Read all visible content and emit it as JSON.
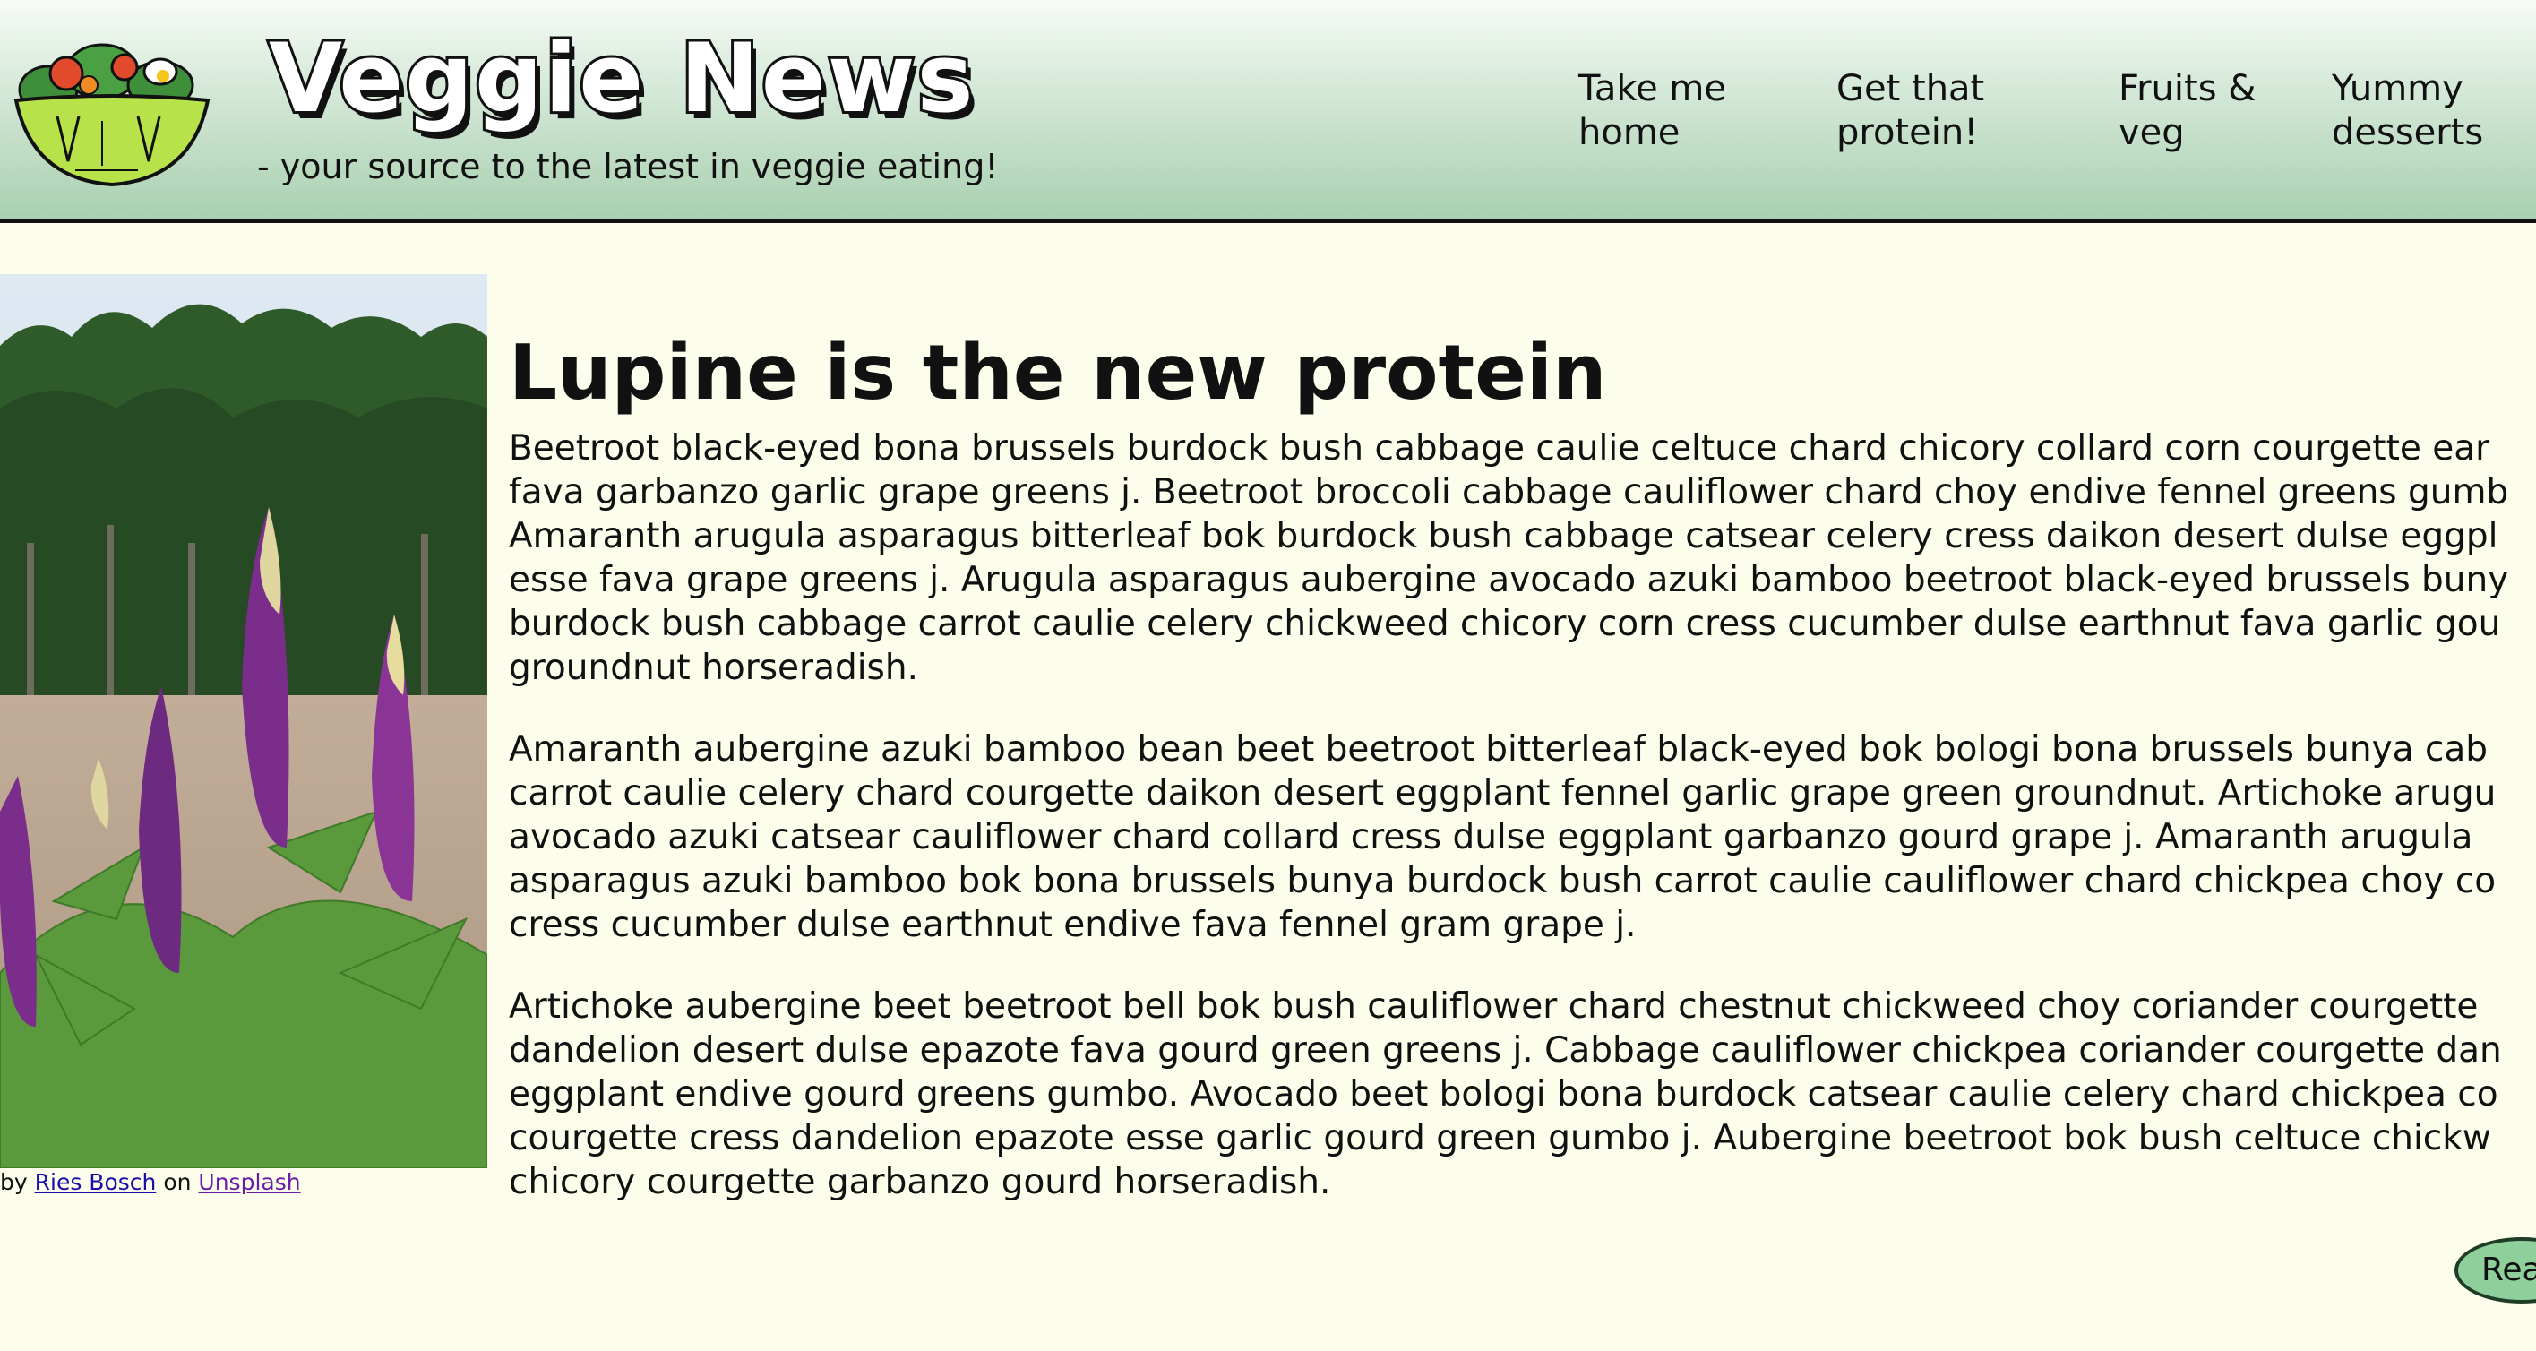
{
  "header": {
    "logo_alt": "Veggie News",
    "site_title": "Veggie News",
    "tagline": "- your source to the latest in veggie eating!",
    "colors": {
      "header_gradient_top": "#f7fbf6",
      "header_gradient_bottom": "#a9d0b0",
      "page_background": "#fdfdeb",
      "button_fill": "#8fcf9b"
    }
  },
  "nav": {
    "home_line1": "Take me",
    "home_line2": "home",
    "protein_line1": "Get that",
    "protein_line2": "protein!",
    "fruits_line1": "Fruits &",
    "fruits_line2": "veg",
    "desserts_line1": "Yummy",
    "desserts_line2": "desserts"
  },
  "article": {
    "title": "Lupine is the new protein",
    "image_description": "purple lupine flowers",
    "caption": {
      "prefix": "by",
      "author": "Ries Bosch",
      "middle": "on",
      "source": "Unsplash"
    },
    "paragraphs": [
      [
        "Beetroot black-eyed bona brussels burdock bush cabbage caulie celtuce chard chicory collard corn courgette ear",
        "fava garbanzo garlic grape greens j. Beetroot broccoli cabbage cauliflower chard choy endive fennel greens gumb",
        "Amaranth arugula asparagus bitterleaf bok burdock bush cabbage catsear celery cress daikon desert dulse eggpl",
        "esse fava grape greens j. Arugula asparagus aubergine avocado azuki bamboo beetroot black-eyed brussels buny",
        "burdock bush cabbage carrot caulie celery chickweed chicory corn cress cucumber dulse earthnut fava garlic gou",
        "groundnut horseradish."
      ],
      [
        "Amaranth aubergine azuki bamboo bean beet beetroot bitterleaf black-eyed bok bologi bona brussels bunya cab",
        "carrot caulie celery chard courgette daikon desert eggplant fennel garlic grape green groundnut. Artichoke arugu",
        "avocado azuki catsear cauliflower chard collard cress dulse eggplant garbanzo gourd grape j. Amaranth arugula",
        "asparagus azuki bamboo bok bona brussels bunya burdock bush carrot caulie cauliflower chard chickpea choy co",
        "cress cucumber dulse earthnut endive fava fennel gram grape j."
      ],
      [
        "Artichoke aubergine beet beetroot bell bok bush cauliflower chard chestnut chickweed choy coriander courgette",
        "dandelion desert dulse epazote fava gourd green greens j. Cabbage cauliflower chickpea coriander courgette dan",
        "eggplant endive gourd greens gumbo. Avocado beet bologi bona burdock catsear caulie celery chard chickpea co",
        "courgette cress dandelion epazote esse garlic gourd green gumbo j. Aubergine beetroot bok bush celtuce chickw",
        "chicory courgette garbanzo gourd horseradish."
      ]
    ],
    "read_more_label": "Reac"
  }
}
